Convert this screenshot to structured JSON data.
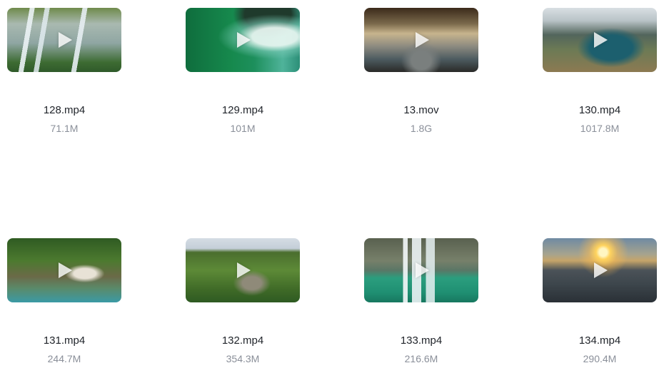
{
  "files": [
    {
      "name": "128.mp4",
      "size": "71.1M",
      "thumb_icon": "waterfall-forest-thumbnail"
    },
    {
      "name": "129.mp4",
      "size": "101M",
      "thumb_icon": "green-river-rapids-thumbnail"
    },
    {
      "name": "13.mov",
      "size": "1.8G",
      "thumb_icon": "forest-stream-thumbnail"
    },
    {
      "name": "130.mp4",
      "size": "1017.8M",
      "thumb_icon": "mountain-lake-aerial-thumbnail"
    },
    {
      "name": "131.mp4",
      "size": "244.7M",
      "thumb_icon": "jungle-waterfall-pool-thumbnail"
    },
    {
      "name": "132.mp4",
      "size": "354.3M",
      "thumb_icon": "forested-mountain-thumbnail"
    },
    {
      "name": "133.mp4",
      "size": "216.6M",
      "thumb_icon": "wide-waterfall-lake-thumbnail"
    },
    {
      "name": "134.mp4",
      "size": "290.4M",
      "thumb_icon": "sunset-beach-thumbnail"
    }
  ],
  "play_icon": "play-icon",
  "colors": {
    "filename": "#1f2329",
    "filesize": "#8a8f99",
    "background": "#ffffff"
  }
}
